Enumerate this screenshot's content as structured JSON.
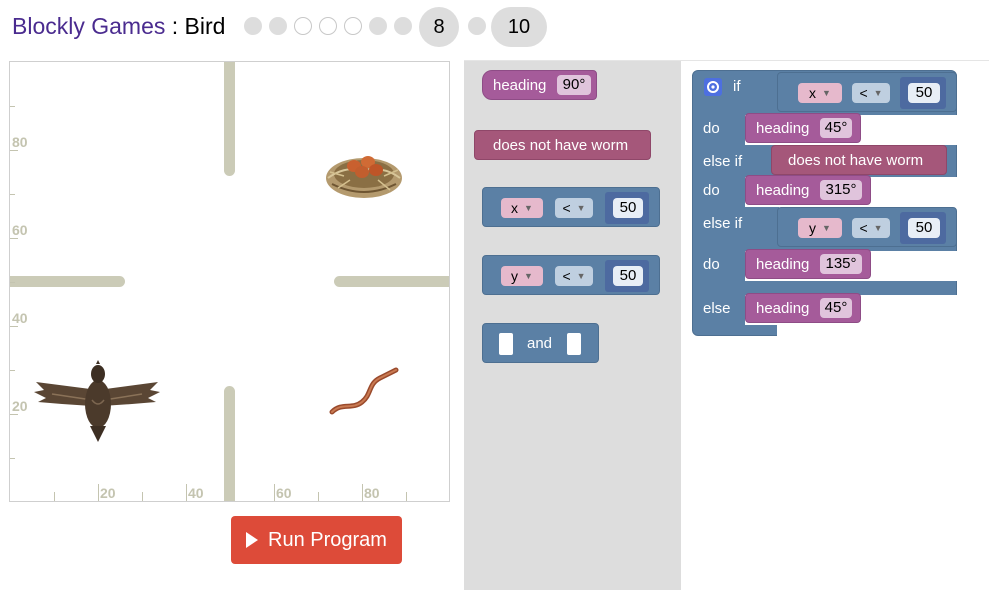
{
  "header": {
    "app_name": "Blockly Games",
    "separator": " : ",
    "game_name": "Bird",
    "levels": [
      {
        "state": "done"
      },
      {
        "state": "done"
      },
      {
        "state": "todo"
      },
      {
        "state": "todo"
      },
      {
        "state": "todo"
      },
      {
        "state": "done"
      },
      {
        "state": "done"
      },
      {
        "label": "8",
        "state": "current"
      },
      {
        "state": "done"
      },
      {
        "label": "10",
        "state": "max"
      }
    ]
  },
  "canvas": {
    "y_ticks": [
      "80",
      "60",
      "40",
      "20"
    ],
    "x_ticks": [
      "20",
      "40",
      "60",
      "80"
    ],
    "objects": [
      "bird",
      "nest",
      "worm"
    ]
  },
  "run_button": {
    "label": "Run Program",
    "icon": "play-icon"
  },
  "toolbox": {
    "heading_label": "heading",
    "heading_value": "90°",
    "no_worm_label": "does not have worm",
    "compare_x": {
      "var": "x",
      "op": "<",
      "value": "50"
    },
    "compare_y": {
      "var": "y",
      "op": "<",
      "value": "50"
    },
    "and_label": "and"
  },
  "workspace": {
    "if_label": "if",
    "do_label": "do",
    "elseif_label": "else if",
    "else_label": "else",
    "gear_icon": "gear-icon",
    "cond1": {
      "var": "x",
      "op": "<",
      "value": "50"
    },
    "do1": {
      "label": "heading",
      "value": "45°"
    },
    "cond2": {
      "label": "does not have worm"
    },
    "do2": {
      "label": "heading",
      "value": "315°"
    },
    "cond3": {
      "var": "y",
      "op": "<",
      "value": "50"
    },
    "do3": {
      "label": "heading",
      "value": "135°"
    },
    "else_do": {
      "label": "heading",
      "value": "45°"
    }
  }
}
